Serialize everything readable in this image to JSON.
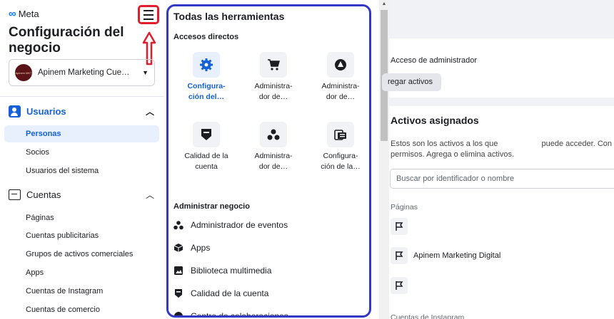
{
  "sidebar": {
    "logo_text": "Meta",
    "page_title": "Configuración del negocio",
    "account_name": "Apinem Marketing Cuent…",
    "avatar_text": "Apinem MKT",
    "users_section": {
      "label": "Usuarios",
      "items": [
        "Personas",
        "Socios",
        "Usuarios del sistema"
      ]
    },
    "accounts_section": {
      "label": "Cuentas",
      "items": [
        "Páginas",
        "Cuentas publicitarias",
        "Grupos de activos comerciales",
        "Apps",
        "Cuentas de Instagram",
        "Cuentas de comercio"
      ]
    }
  },
  "tools_panel": {
    "title": "Todas las herramientas",
    "shortcuts_heading": "Accesos directos",
    "shortcuts": [
      {
        "line1": "Configura-",
        "line2": "ción del…",
        "icon": "gear-icon"
      },
      {
        "line1": "Administra-",
        "line2": "dor de…",
        "icon": "cart-icon"
      },
      {
        "line1": "Administra-",
        "line2": "dor de…",
        "icon": "triangle-icon"
      },
      {
        "line1": "Calidad de la",
        "line2": "cuenta",
        "icon": "shield-icon"
      },
      {
        "line1": "Administra-",
        "line2": "dor de…",
        "icon": "events-icon"
      },
      {
        "line1": "Configura-",
        "line2": "ción de la…",
        "icon": "catalog-icon"
      }
    ],
    "manage_heading": "Administrar negocio",
    "manage_items": [
      "Administrador de eventos",
      "Apps",
      "Biblioteca multimedia",
      "Calidad de la cuenta",
      "Centro de colaboraciones"
    ]
  },
  "main": {
    "admin_access": "Acceso de administrador",
    "add_assets_button": "regar activos",
    "assigned_title": "Activos asignados",
    "assigned_desc_line1": "Estos son los activos a los que                    puede acceder. Con",
    "assigned_desc_line2": "permisos. Agrega o elimina activos.",
    "search_placeholder": "Buscar por identificador o nombre",
    "pages_label": "Páginas",
    "page_name": "Apinem Marketing Digital",
    "instagram_label": "Cuentas de Instagram"
  },
  "colors": {
    "accent": "#1461d9",
    "highlight_red": "#e01e2d",
    "panel_border": "#3338c8"
  }
}
